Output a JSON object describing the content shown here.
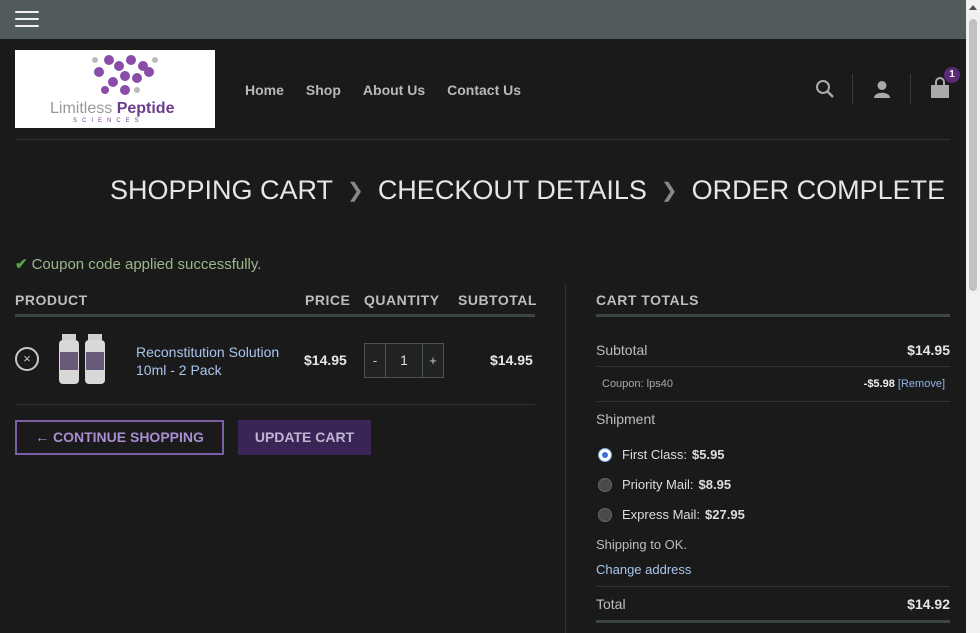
{
  "header": {
    "logo": {
      "word1": "Limitless",
      "word2": "Peptide",
      "sub": "SCIENCES"
    },
    "nav": [
      "Home",
      "Shop",
      "About Us",
      "Contact Us"
    ],
    "cart_count": "1"
  },
  "breadcrumb": {
    "steps": [
      "SHOPPING CART",
      "CHECKOUT DETAILS",
      "ORDER COMPLETE"
    ]
  },
  "notice": "Coupon code applied successfully.",
  "cart": {
    "headers": {
      "product": "PRODUCT",
      "price": "PRICE",
      "quantity": "QUANTITY",
      "subtotal": "SUBTOTAL"
    },
    "item": {
      "name": "Reconstitution Solution 10ml - 2 Pack",
      "price": "$14.95",
      "qty": "1",
      "qty_minus": "-",
      "qty_plus": "+",
      "subtotal": "$14.95",
      "remove": "×"
    },
    "continue_label": "← CONTINUE SHOPPING",
    "update_label": "UPDATE CART"
  },
  "totals": {
    "title": "CART TOTALS",
    "subtotal_label": "Subtotal",
    "subtotal": "$14.95",
    "coupon_label": "Coupon: lps40",
    "coupon_amount": "-$5.98",
    "coupon_remove": "[Remove]",
    "shipment_label": "Shipment",
    "shipping_options": [
      {
        "name": "First Class:",
        "price": "$5.95",
        "selected": true
      },
      {
        "name": "Priority Mail:",
        "price": "$8.95",
        "selected": false
      },
      {
        "name": "Express Mail:",
        "price": "$27.95",
        "selected": false
      }
    ],
    "shipping_to": "Shipping to OK.",
    "change_address": "Change address",
    "total_label": "Total",
    "total": "$14.92"
  },
  "colors": {
    "accent": "#5b2b7a",
    "link": "#a9c6ee",
    "success": "#9bb78a"
  }
}
